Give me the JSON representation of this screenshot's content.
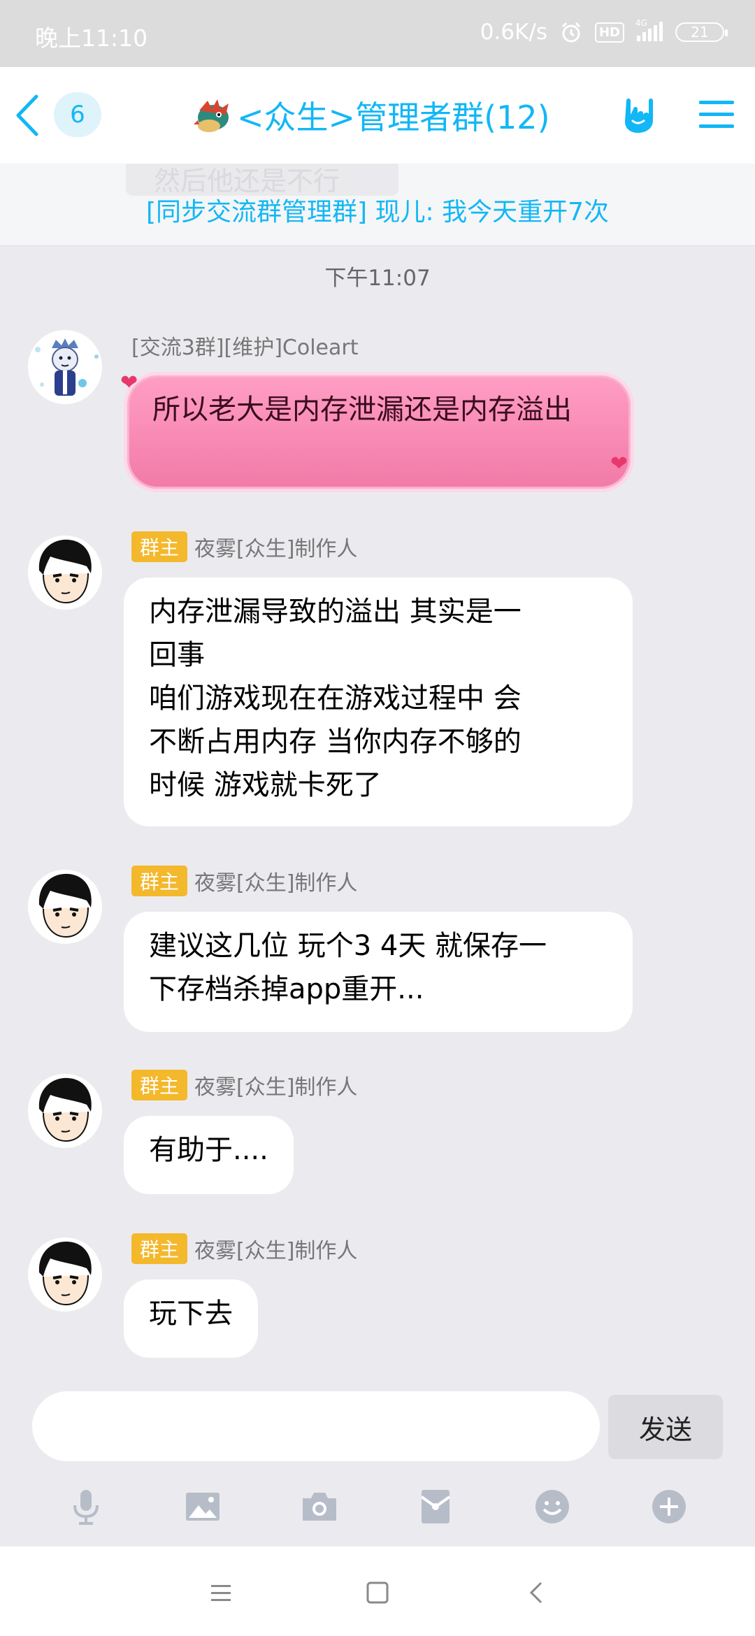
{
  "status_bar": {
    "time": "晚上11:10",
    "speed": "0.6K/s",
    "hd": "HD",
    "net": "4G",
    "battery": "21"
  },
  "nav": {
    "unread_count": "6",
    "title": "<众生>管理者群(12)"
  },
  "notice": {
    "ghost_text": "然后他还是不行",
    "text": "[同步交流群管理群] 现儿: 我今天重开7次"
  },
  "time_divider": "下午11:07",
  "messages": [
    {
      "sender": "[交流3群][维护]Coleart",
      "badge": "",
      "text": "所以老大是内存泄漏还是内存溢出"
    },
    {
      "sender": "夜雾[众生]制作人",
      "badge": "群主",
      "text_lines": [
        "内存泄漏导致的溢出 其实是一",
        "回事",
        "咱们游戏现在在游戏过程中 会",
        "不断占用内存 当你内存不够的",
        "时候 游戏就卡死了"
      ]
    },
    {
      "sender": "夜雾[众生]制作人",
      "badge": "群主",
      "text_lines": [
        "建议这几位 玩个3 4天 就保存一",
        "下存档杀掉app重开..."
      ]
    },
    {
      "sender": "夜雾[众生]制作人",
      "badge": "群主",
      "text": "有助于...."
    },
    {
      "sender": "夜雾[众生]制作人",
      "badge": "群主",
      "text": "玩下去"
    }
  ],
  "input": {
    "send_label": "发送"
  },
  "toolbar": [
    "microphone-icon",
    "image-icon",
    "camera-icon",
    "red-packet-icon",
    "emoji-icon",
    "plus-icon"
  ],
  "colors": {
    "accent": "#12b7f5",
    "badge": "#f4b82c",
    "background": "#ebebef"
  }
}
